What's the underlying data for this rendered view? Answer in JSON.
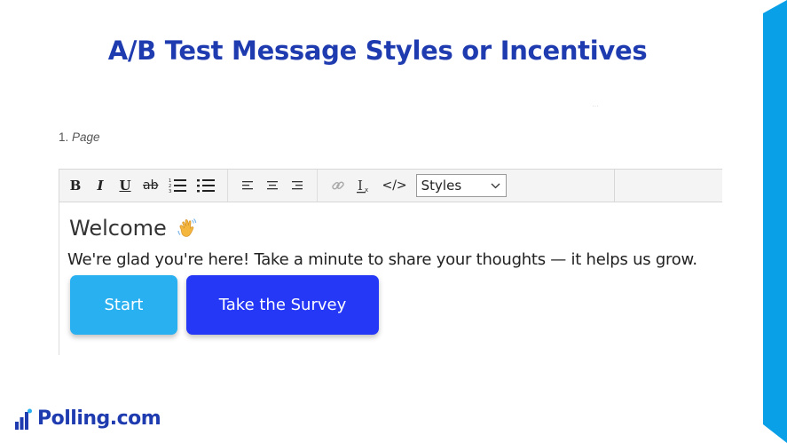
{
  "slide": {
    "title": "A/B Test Message Styles or Incentives",
    "title_color": "#1f3bb0",
    "side_bar_color": "#0aa0e8"
  },
  "section": {
    "number": "1.",
    "label": "Page"
  },
  "toolbar": {
    "bold_label": "B",
    "italic_label": "I",
    "underline_label": "U",
    "strikethrough_label": "ab",
    "ordered_list_icon": "ordered-list-icon",
    "bullet_list_icon": "bullet-list-icon",
    "align_left_icon": "align-left-icon",
    "align_center_icon": "align-center-icon",
    "align_right_icon": "align-right-icon",
    "link_icon": "link-icon",
    "clear_format_label": "Ix",
    "code_label": "</>",
    "styles_value": "Styles"
  },
  "content": {
    "heading": "Welcome",
    "heading_emoji": "waving-hand-icon",
    "body_text": "We're glad you're here! Take a minute to share your thoughts — it helps us grow."
  },
  "buttons": {
    "start_label": "Start",
    "start_color": "#29b0f0",
    "survey_label": "Take the Survey",
    "survey_color": "#2438f5"
  },
  "brand": {
    "name": "Polling.com",
    "logo_icon": "polling-logo-icon",
    "color": "#1f3bb0"
  }
}
